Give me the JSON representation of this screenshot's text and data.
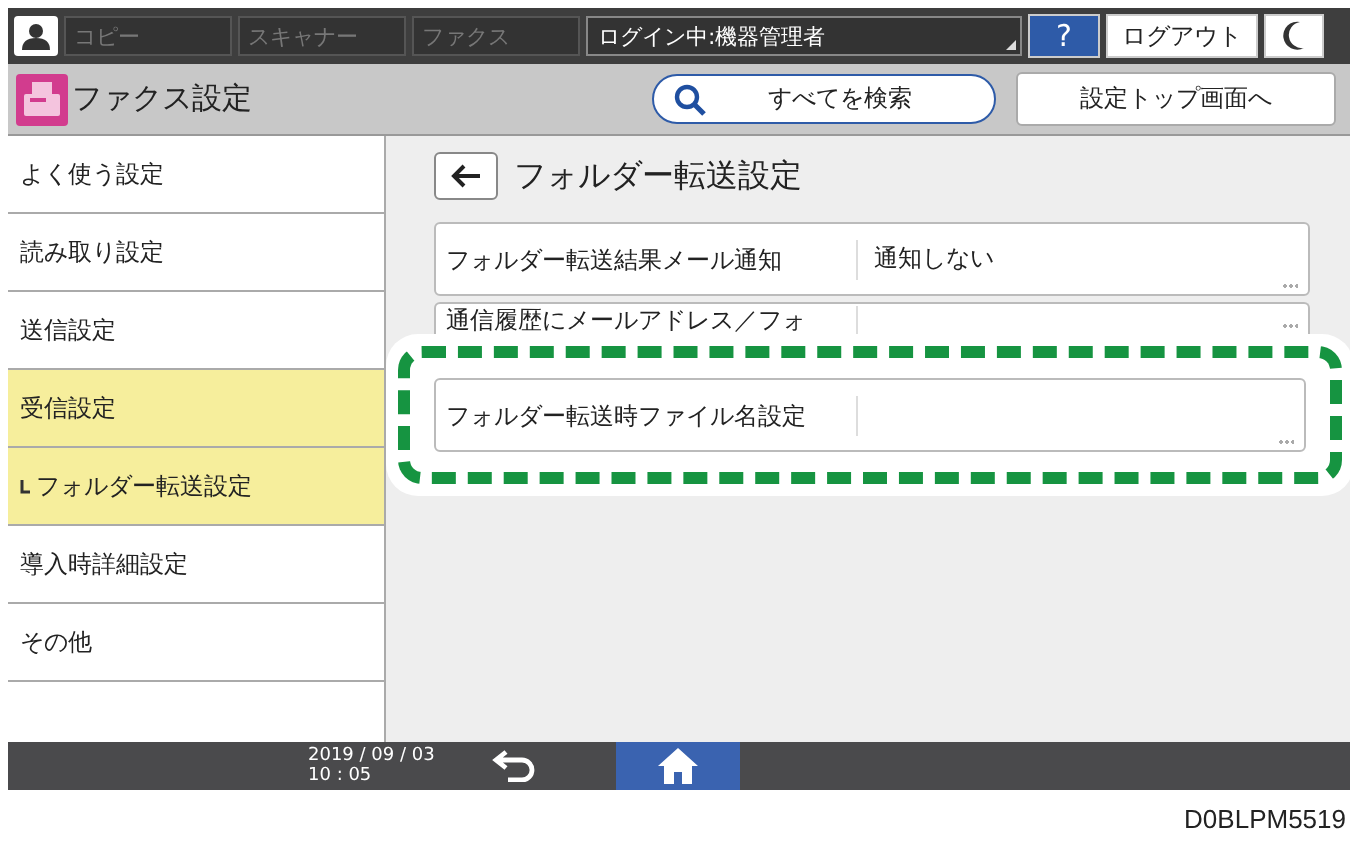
{
  "top_bar": {
    "apps": [
      {
        "label": "コピー",
        "disabled": true
      },
      {
        "label": "スキャナー",
        "disabled": true
      },
      {
        "label": "ファクス",
        "disabled": true
      }
    ],
    "login_status": "ログイン中:機器管理者",
    "help": "?",
    "logout": "ログアウト"
  },
  "header": {
    "title": "ファクス設定",
    "search": "すべてを検索",
    "top_button": "設定トップ画面へ"
  },
  "sidebar": {
    "items": [
      {
        "label": "よく使う設定",
        "selected": false
      },
      {
        "label": "読み取り設定",
        "selected": false
      },
      {
        "label": "送信設定",
        "selected": false
      },
      {
        "label": "受信設定",
        "selected": true,
        "children": [
          {
            "label": "フォルダー転送設定",
            "selected": true
          }
        ]
      },
      {
        "label": "導入時詳細設定",
        "selected": false
      },
      {
        "label": "その他",
        "selected": false
      }
    ]
  },
  "page": {
    "title": "フォルダー転送設定",
    "settings": [
      {
        "label": "フォルダー転送結果メール通知",
        "value": "通知しない",
        "highlighted": false
      },
      {
        "label": "通信履歴にメールアドレス／フォ",
        "highlighted": false
      },
      {
        "label": "フォルダー転送時ファイル名設定",
        "highlighted": true
      }
    ]
  },
  "status_bar": {
    "date": "2019 / 09 / 03",
    "time": "10 : 05",
    "home_selected": true
  },
  "caption": "D0BLPM5519"
}
